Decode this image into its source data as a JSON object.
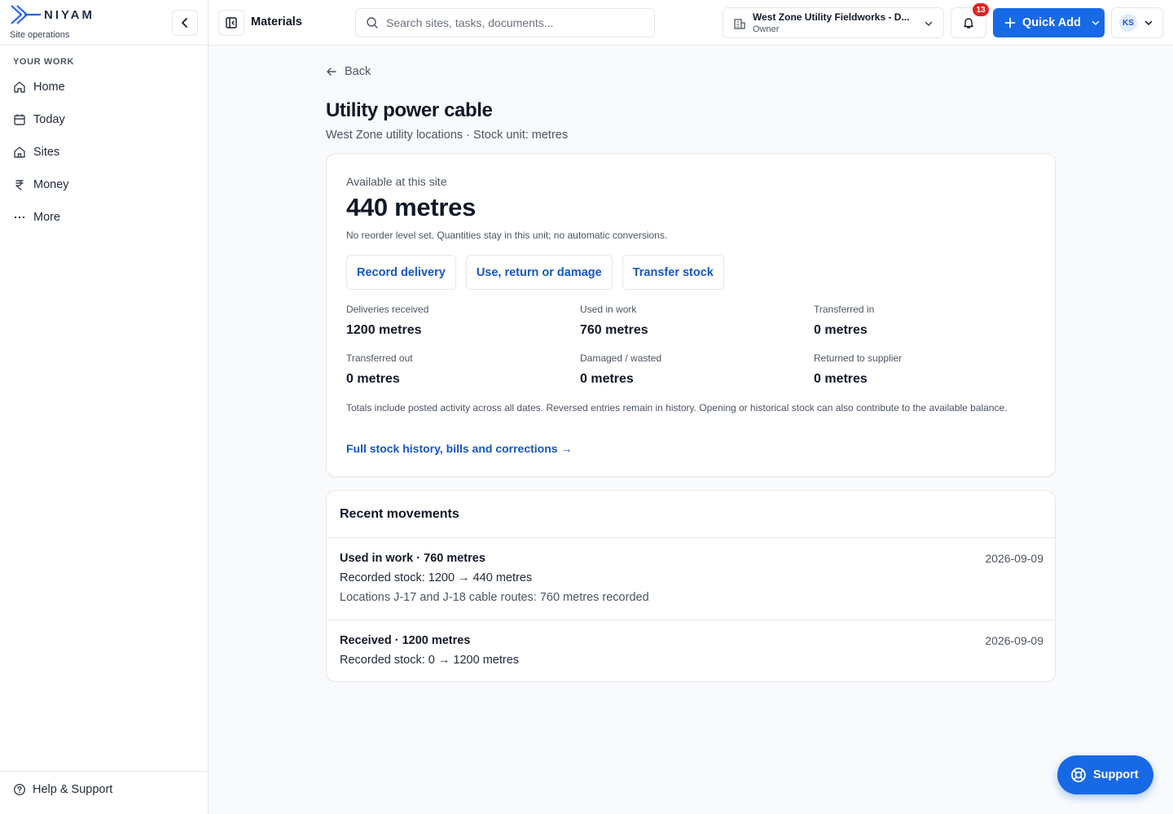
{
  "brand": {
    "name": "NIYAM",
    "subtitle": "Site operations"
  },
  "sidebar": {
    "section_label": "YOUR WORK",
    "items": [
      {
        "label": "Home",
        "icon": "home-icon"
      },
      {
        "label": "Today",
        "icon": "calendar-icon"
      },
      {
        "label": "Sites",
        "icon": "building-icon"
      },
      {
        "label": "Money",
        "icon": "rupee-icon"
      },
      {
        "label": "More",
        "icon": "more-dots-icon"
      }
    ],
    "help_label": "Help & Support"
  },
  "topbar": {
    "page_title": "Materials",
    "search_placeholder": "Search sites, tasks, documents...",
    "org_name": "West Zone Utility Fieldworks - D...",
    "org_role": "Owner",
    "notification_count": "13",
    "quick_add_label": "Quick Add",
    "avatar_initials": "KS"
  },
  "colors": {
    "accent": "#1769e6",
    "link": "#1257c4",
    "badge": "#dc2626"
  },
  "main": {
    "back_label": "Back",
    "title": "Utility power cable",
    "subtitle": "West Zone utility locations · Stock unit: metres",
    "available_label": "Available at this site",
    "available_value": "440 metres",
    "available_note": "No reorder level set. Quantities stay in this unit; no automatic conversions.",
    "actions": [
      "Record delivery",
      "Use, return or damage",
      "Transfer stock"
    ],
    "stats": [
      {
        "label": "Deliveries received",
        "value": "1200 metres"
      },
      {
        "label": "Used in work",
        "value": "760 metres"
      },
      {
        "label": "Transferred in",
        "value": "0 metres"
      },
      {
        "label": "Transferred out",
        "value": "0 metres"
      },
      {
        "label": "Damaged / wasted",
        "value": "0 metres"
      },
      {
        "label": "Returned to supplier",
        "value": "0 metres"
      }
    ],
    "totals_note": "Totals include posted activity across all dates. Reversed entries remain in history. Opening or historical stock can also contribute to the available balance.",
    "history_link": "Full stock history, bills and corrections →"
  },
  "movements": {
    "title": "Recent movements",
    "rows": [
      {
        "heading": "Used in work · 760 metres",
        "date": "2026-09-09",
        "stock_line": "Recorded stock: 1200 → 440 metres",
        "note": "Locations J-17 and J-18 cable routes: 760 metres recorded"
      },
      {
        "heading": "Received · 1200 metres",
        "date": "2026-09-09",
        "stock_line": "Recorded stock: 0 → 1200 metres"
      }
    ]
  },
  "support_label": "Support"
}
